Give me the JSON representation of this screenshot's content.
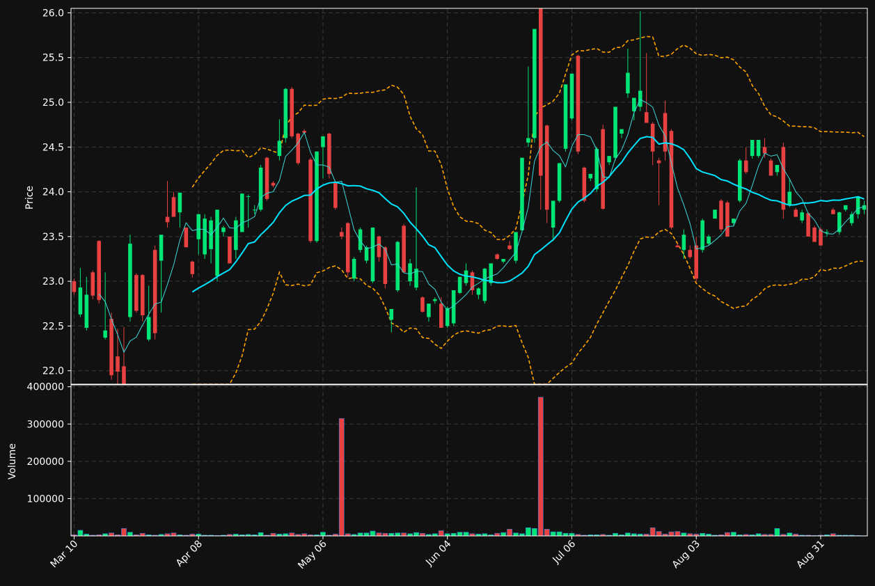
{
  "chart_data": {
    "type": "candlestick",
    "panels": {
      "price": {
        "ylabel": "Price",
        "ylim": [
          21.85,
          26.05
        ],
        "yticks": [
          22.0,
          22.5,
          23.0,
          23.5,
          24.0,
          24.5,
          25.0,
          25.5,
          26.0
        ]
      },
      "volume": {
        "ylabel": "Volume",
        "ylim": [
          0,
          405000
        ],
        "yticks": [
          100000,
          200000,
          300000,
          400000
        ]
      }
    },
    "x_tick_labels": [
      "Mar 10",
      "Apr 08",
      "May 06",
      "Jun 04",
      "Jul 06",
      "Aug 03",
      "Aug 31"
    ],
    "x_tick_indices": [
      0,
      20,
      40,
      60,
      80,
      100,
      120
    ],
    "grid": true,
    "colors": {
      "up": "#00e676",
      "down": "#e84142",
      "ma_fast": "#3ed8d8",
      "ma_slow": "#00e5ff",
      "bands": "#ffa500",
      "volume_edge": "#3a7bd5",
      "background": "#111111",
      "axis": "#ffffff"
    },
    "ohlc": [
      [
        23.0,
        23.03,
        22.85,
        22.88
      ],
      [
        22.63,
        23.15,
        22.6,
        22.93
      ],
      [
        22.48,
        23.05,
        22.45,
        22.85
      ],
      [
        23.1,
        23.12,
        22.8,
        22.84
      ],
      [
        23.45,
        23.46,
        22.75,
        22.79
      ],
      [
        22.37,
        23.1,
        22.35,
        22.45
      ],
      [
        22.58,
        22.65,
        21.9,
        21.95
      ],
      [
        22.16,
        22.47,
        21.8,
        21.99
      ],
      [
        22.05,
        22.49,
        21.75,
        21.85
      ],
      [
        22.6,
        23.52,
        22.55,
        23.42
      ],
      [
        23.07,
        23.09,
        22.65,
        22.67
      ],
      [
        23.07,
        23.08,
        22.55,
        22.62
      ],
      [
        22.35,
        22.95,
        22.33,
        22.6
      ],
      [
        23.35,
        23.4,
        22.35,
        22.42
      ],
      [
        23.23,
        23.52,
        22.65,
        23.52
      ],
      [
        23.72,
        24.12,
        23.6,
        23.66
      ],
      [
        23.94,
        24.0,
        23.72,
        23.72
      ],
      [
        23.77,
        23.99,
        23.6,
        23.99
      ],
      [
        23.6,
        23.6,
        23.38,
        23.38
      ],
      [
        23.22,
        23.23,
        23.04,
        23.08
      ],
      [
        23.47,
        23.75,
        23.3,
        23.75
      ],
      [
        23.3,
        23.75,
        23.25,
        23.7
      ],
      [
        23.36,
        23.72,
        23.2,
        23.68
      ],
      [
        23.06,
        23.8,
        23.0,
        23.8
      ],
      [
        23.55,
        23.62,
        23.5,
        23.6
      ],
      [
        23.5,
        23.5,
        23.2,
        23.2
      ],
      [
        23.35,
        23.72,
        23.25,
        23.68
      ],
      [
        23.55,
        23.98,
        23.55,
        23.98
      ],
      [
        23.95,
        23.97,
        23.6,
        23.95
      ],
      [
        23.8,
        23.85,
        23.75,
        23.8
      ],
      [
        23.8,
        24.3,
        23.78,
        24.27
      ],
      [
        24.38,
        24.39,
        23.9,
        23.92
      ],
      [
        24.1,
        24.12,
        24.05,
        24.07
      ],
      [
        24.4,
        24.81,
        24.35,
        24.57
      ],
      [
        24.6,
        25.16,
        24.55,
        25.15
      ],
      [
        25.15,
        25.17,
        24.6,
        24.62
      ],
      [
        24.65,
        24.66,
        24.3,
        24.32
      ],
      [
        24.68,
        24.7,
        24.65,
        24.66
      ],
      [
        24.36,
        24.38,
        23.43,
        23.45
      ],
      [
        23.45,
        24.45,
        23.43,
        24.45
      ],
      [
        24.5,
        24.61,
        24.15,
        24.62
      ],
      [
        24.65,
        24.66,
        24.15,
        24.2
      ],
      [
        24.1,
        24.12,
        23.8,
        23.82
      ],
      [
        23.55,
        23.6,
        23.47,
        23.5
      ],
      [
        23.65,
        23.66,
        23.05,
        23.1
      ],
      [
        23.03,
        23.27,
        23.0,
        23.25
      ],
      [
        23.35,
        23.6,
        23.32,
        23.58
      ],
      [
        23.23,
        23.4,
        23.2,
        23.38
      ],
      [
        23.0,
        23.6,
        22.98,
        23.6
      ],
      [
        23.5,
        23.51,
        23.22,
        23.27
      ],
      [
        23.38,
        23.39,
        22.92,
        22.97
      ],
      [
        22.57,
        22.68,
        22.43,
        22.69
      ],
      [
        22.9,
        23.45,
        22.88,
        23.44
      ],
      [
        23.62,
        23.64,
        23.12,
        23.1
      ],
      [
        23.0,
        23.25,
        22.95,
        23.2
      ],
      [
        22.93,
        24.05,
        22.9,
        23.14
      ],
      [
        22.82,
        22.83,
        22.65,
        22.66
      ],
      [
        22.6,
        22.75,
        22.55,
        22.75
      ],
      [
        22.78,
        22.82,
        22.75,
        22.8
      ],
      [
        22.75,
        22.82,
        22.5,
        22.48
      ],
      [
        22.5,
        22.72,
        22.48,
        22.7
      ],
      [
        22.53,
        22.9,
        22.5,
        22.9
      ],
      [
        22.87,
        23.05,
        22.86,
        23.05
      ],
      [
        22.98,
        23.2,
        22.95,
        23.12
      ],
      [
        23.1,
        23.12,
        22.85,
        22.9
      ],
      [
        22.85,
        22.93,
        22.8,
        22.92
      ],
      [
        22.78,
        23.15,
        22.75,
        23.14
      ],
      [
        22.98,
        23.2,
        22.95,
        23.2
      ],
      [
        23.3,
        23.31,
        23.24,
        23.25
      ],
      [
        23.22,
        23.25,
        23.2,
        23.25
      ],
      [
        23.4,
        23.45,
        23.35,
        23.36
      ],
      [
        23.23,
        23.55,
        23.2,
        23.55
      ],
      [
        23.57,
        24.38,
        23.55,
        24.38
      ],
      [
        24.55,
        25.4,
        24.5,
        24.6
      ],
      [
        24.6,
        25.8,
        24.55,
        25.82
      ],
      [
        26.05,
        26.1,
        23.8,
        24.18
      ],
      [
        24.74,
        24.75,
        23.65,
        23.8
      ],
      [
        23.6,
        23.62,
        23.45,
        23.9
      ],
      [
        23.9,
        24.32,
        23.88,
        24.32
      ],
      [
        24.48,
        25.2,
        24.45,
        25.2
      ],
      [
        24.82,
        25.32,
        24.8,
        25.32
      ],
      [
        25.52,
        25.53,
        24.42,
        24.45
      ],
      [
        24.27,
        24.28,
        23.88,
        23.9
      ],
      [
        24.15,
        24.2,
        24.12,
        24.2
      ],
      [
        24.03,
        24.5,
        24.0,
        24.48
      ],
      [
        24.7,
        24.75,
        23.8,
        23.81
      ],
      [
        24.33,
        24.4,
        24.3,
        24.4
      ],
      [
        24.38,
        24.95,
        24.35,
        24.95
      ],
      [
        24.65,
        24.7,
        24.6,
        24.7
      ],
      [
        25.1,
        25.6,
        25.05,
        25.33
      ],
      [
        24.9,
        25.05,
        24.8,
        25.05
      ],
      [
        24.95,
        26.02,
        24.9,
        25.13
      ],
      [
        24.89,
        25.55,
        24.78,
        24.77
      ],
      [
        24.76,
        24.78,
        24.3,
        24.45
      ],
      [
        24.35,
        24.38,
        23.85,
        24.32
      ],
      [
        24.88,
        25.02,
        24.35,
        24.45
      ],
      [
        24.68,
        24.7,
        23.58,
        23.6
      ],
      [
        23.4,
        23.42,
        23.38,
        23.38
      ],
      [
        23.35,
        23.58,
        23.25,
        23.52
      ],
      [
        23.35,
        23.4,
        23.25,
        23.27
      ],
      [
        23.4,
        23.5,
        23.0,
        23.03
      ],
      [
        23.35,
        23.7,
        23.32,
        23.68
      ],
      [
        23.42,
        23.52,
        23.4,
        23.5
      ],
      [
        23.7,
        23.8,
        23.7,
        23.8
      ],
      [
        23.9,
        23.92,
        23.55,
        23.58
      ],
      [
        23.88,
        23.9,
        23.5,
        23.5
      ],
      [
        23.65,
        23.7,
        23.62,
        23.7
      ],
      [
        23.9,
        24.37,
        23.88,
        24.35
      ],
      [
        24.35,
        24.5,
        24.2,
        24.22
      ],
      [
        24.4,
        24.55,
        24.37,
        24.58
      ],
      [
        24.4,
        24.55,
        24.38,
        24.58
      ],
      [
        24.5,
        24.6,
        24.38,
        24.43
      ],
      [
        24.35,
        24.37,
        24.18,
        24.18
      ],
      [
        24.22,
        24.3,
        24.18,
        24.3
      ],
      [
        24.5,
        24.55,
        23.7,
        23.8
      ],
      [
        23.85,
        24.15,
        23.83,
        24.0
      ],
      [
        23.8,
        23.82,
        23.72,
        23.72
      ],
      [
        23.68,
        23.8,
        23.65,
        23.77
      ],
      [
        23.76,
        23.77,
        23.5,
        23.5
      ],
      [
        23.6,
        23.62,
        23.45,
        23.44
      ],
      [
        23.58,
        23.6,
        23.4,
        23.4
      ],
      [
        23.55,
        23.58,
        23.5,
        23.55
      ],
      [
        23.8,
        23.82,
        23.75,
        23.75
      ],
      [
        23.55,
        23.78,
        23.52,
        23.77
      ],
      [
        23.8,
        23.85,
        23.78,
        23.85
      ],
      [
        23.65,
        23.78,
        23.62,
        23.75
      ],
      [
        23.75,
        23.95,
        23.7,
        23.95
      ],
      [
        23.8,
        23.9,
        23.75,
        23.85
      ]
    ],
    "volume": [
      3000,
      15000,
      5000,
      2000,
      3000,
      6000,
      8000,
      3000,
      20000,
      10000,
      3000,
      7000,
      3000,
      2000,
      4000,
      6000,
      8000,
      3000,
      2000,
      5000,
      5000,
      2000,
      2000,
      1000,
      2000,
      4000,
      5000,
      3000,
      4000,
      3000,
      9000,
      2000,
      7000,
      5000,
      6000,
      8000,
      4000,
      6000,
      3000,
      3000,
      10000,
      2000,
      5000,
      315000,
      6000,
      4000,
      8000,
      8000,
      13000,
      8000,
      7000,
      7000,
      8000,
      8000,
      6000,
      9000,
      7000,
      4000,
      6000,
      14000,
      6000,
      7000,
      10000,
      10000,
      6000,
      5000,
      6000,
      3000,
      7000,
      9000,
      18000,
      8000,
      6000,
      22000,
      20000,
      372000,
      18000,
      11000,
      11000,
      7000,
      7000,
      4000,
      2000,
      3000,
      3000,
      4000,
      2000,
      7000,
      3000,
      8000,
      6000,
      5000,
      5000,
      22000,
      12000,
      5000,
      11000,
      12000,
      8000,
      6000,
      5000,
      7000,
      5000,
      2000,
      3000,
      9000,
      10000,
      3000,
      4000,
      3000,
      6000,
      4000,
      4000,
      20000,
      4000,
      8000,
      5000,
      2000,
      2000,
      1000,
      2000,
      3000,
      6000,
      2000,
      2000,
      2000,
      1000
    ]
  }
}
